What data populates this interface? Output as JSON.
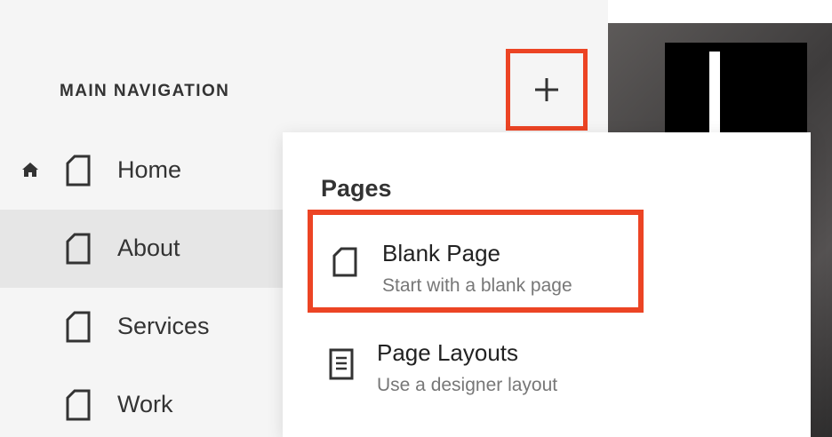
{
  "navigation": {
    "heading": "MAIN NAVIGATION",
    "items": [
      {
        "label": "Home",
        "icon": "page-icon",
        "is_home": true,
        "selected": false
      },
      {
        "label": "About",
        "icon": "page-icon",
        "is_home": false,
        "selected": true
      },
      {
        "label": "Services",
        "icon": "page-icon",
        "is_home": false,
        "selected": false
      },
      {
        "label": "Work",
        "icon": "page-icon",
        "is_home": false,
        "selected": false
      }
    ]
  },
  "add_button": {
    "icon": "plus-icon"
  },
  "menu": {
    "heading": "Pages",
    "options": [
      {
        "title": "Blank Page",
        "subtitle": "Start with a blank page",
        "icon": "blank-page-icon"
      },
      {
        "title": "Page Layouts",
        "subtitle": "Use a designer layout",
        "icon": "layout-page-icon"
      }
    ]
  },
  "colors": {
    "highlight": "#ec4424",
    "panel_bg": "#f5f5f5",
    "selected_bg": "#e6e6e6",
    "text": "#333333",
    "subtext": "#777777"
  }
}
